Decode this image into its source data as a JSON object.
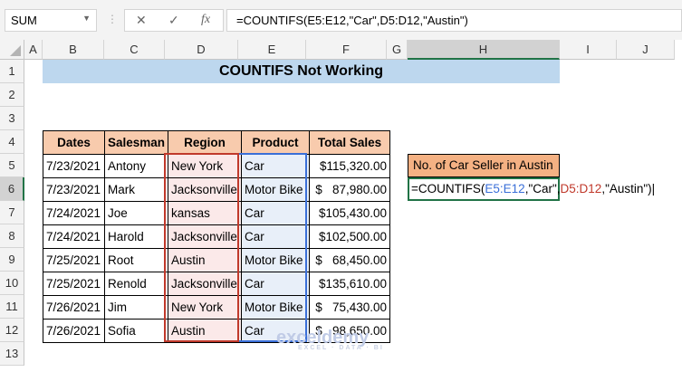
{
  "formula_bar": {
    "name_box": "SUM",
    "cancel_icon": "✕",
    "enter_icon": "✓",
    "fx_icon": "fx",
    "formula": "=COUNTIFS(E5:E12,\"Car\",D5:D12,\"Austin\")"
  },
  "columns": [
    "A",
    "B",
    "C",
    "D",
    "E",
    "F",
    "G",
    "H",
    "I",
    "J"
  ],
  "rows": [
    "1",
    "2",
    "3",
    "4",
    "5",
    "6",
    "7",
    "8",
    "9",
    "10",
    "11",
    "12",
    "13"
  ],
  "title": "COUNTIFS Not Working",
  "table": {
    "headers": [
      "Dates",
      "Salesman",
      "Region",
      "Product",
      "Total Sales"
    ],
    "rows": [
      [
        "7/23/2021",
        "Antony",
        "New York",
        "Car",
        "$115,320.00"
      ],
      [
        "7/23/2021",
        "Mark",
        "Jacksonville",
        "Motor Bike",
        "$   87,980.00"
      ],
      [
        "7/24/2021",
        "Joe",
        "kansas",
        "Car",
        "$105,430.00"
      ],
      [
        "7/24/2021",
        "Harold",
        "Jacksonville",
        "Car",
        "$102,500.00"
      ],
      [
        "7/25/2021",
        "Root",
        "Austin",
        "Motor Bike",
        "$   68,450.00"
      ],
      [
        "7/25/2021",
        "Renold",
        "Jacksonville",
        "Car",
        "$135,610.00"
      ],
      [
        "7/26/2021",
        "Jim",
        "New York",
        "Motor Bike",
        "$   75,430.00"
      ],
      [
        "7/26/2021",
        "Sofia",
        "Austin",
        "Car",
        "$   98,650.00"
      ]
    ]
  },
  "result": {
    "label": "No. of Car Seller in Austin",
    "formula_parts": [
      "=COUNTIFS(",
      "E5:E12",
      ",\"Car\",",
      "D5:D12",
      ",\"Austin\")"
    ]
  },
  "watermark": {
    "name": "exceldemy",
    "tagline": "EXCEL · DATA · BI"
  },
  "colors": {
    "header_fill": "#f8cbad",
    "title_fill": "#bdd7ee",
    "label_fill": "#f4b183",
    "range_red": "#c0392b",
    "range_blue": "#3a6fd8",
    "active_border": "#217346"
  }
}
